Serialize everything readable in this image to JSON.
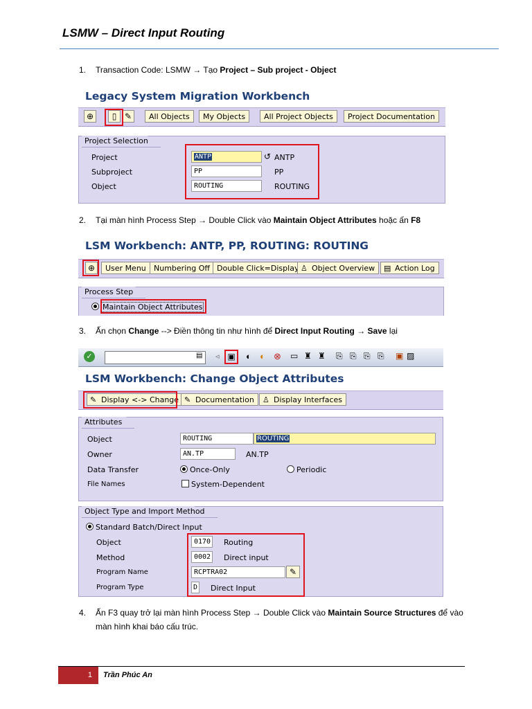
{
  "document": {
    "title": "LSMW  – Direct Input Routing",
    "footer_page": "1",
    "footer_author": "Trần Phúc An"
  },
  "steps": [
    {
      "num": "1.",
      "text_a": "Transaction Code:  LSMW ",
      "arrow": "→",
      "text_b": " Tạo  ",
      "bold": "Project – Sub project  - Object",
      "text_c": ""
    },
    {
      "num": "2.",
      "text_a": "Tại màn hình Process Step ",
      "arrow": "→",
      "text_b": " Double Click vào ",
      "bold": "Maintain Object Attributes",
      "text_c": " hoặc ấn ",
      "bold2": "F8"
    },
    {
      "num": "3.",
      "text_a": "Ấn chọn ",
      "bold": "Change",
      "text_b": " --> Điền thông tin như hình để ",
      "bold2": "Direct Input Routing",
      "arrow": "→",
      "bold3": "Save",
      "text_c": " lại"
    },
    {
      "num": "4.",
      "text_a": "Ấn F3 quay trở lại màn hình Process Step ",
      "arrow": "→",
      "text_b": " Double Click vào ",
      "bold": "Maintain Source Structures",
      "text_c": " để vào",
      "line2": "màn hình khai báo cấu trúc."
    }
  ],
  "screen1": {
    "title": "Legacy System Migration Workbench",
    "buttons": [
      "All Objects",
      "My Objects",
      "All Project Objects",
      "Project Documentation"
    ],
    "section": "Project Selection",
    "fields": [
      {
        "label": "Project",
        "value": "ANTP",
        "desc": "ANTP"
      },
      {
        "label": "Subproject",
        "value": "PP",
        "desc": "PP"
      },
      {
        "label": "Object",
        "value": "ROUTING",
        "desc": "ROUTING"
      }
    ]
  },
  "screen2": {
    "title": "LSM Workbench: ANTP, PP, ROUTING: ROUTING",
    "buttons": [
      "User Menu",
      "Numbering Off",
      "Double Click=Display",
      "Object Overview",
      "Action Log"
    ],
    "section": "Process Step",
    "step_item": "Maintain Object Attributes"
  },
  "screen3": {
    "title": "LSM Workbench: Change Object Attributes",
    "buttons": [
      "Display <-> Change",
      "Documentation",
      "Display Interfaces"
    ],
    "attributes_section": "Attributes",
    "object_label": "Object",
    "object_value": "ROUTING",
    "object_desc": "ROUTING",
    "owner_label": "Owner",
    "owner_value": "AN.TP",
    "owner_desc": "AN.TP",
    "data_transfer_label": "Data Transfer",
    "once_only": "Once-Only",
    "periodic": "Periodic",
    "file_names_label": "File Names",
    "system_dependent": "System-Dependent",
    "import_section": "Object Type and Import Method",
    "standard_batch": "Standard Batch/Direct Input",
    "import_fields": [
      {
        "label": "Object",
        "value": "0170",
        "desc": "Routing"
      },
      {
        "label": "Method",
        "value": "0002",
        "desc": "Direct input"
      },
      {
        "label": "Program Name",
        "value": "RCPTRA02",
        "desc": ""
      },
      {
        "label": "Program Type",
        "value": "D",
        "desc": "Direct Input"
      }
    ]
  }
}
